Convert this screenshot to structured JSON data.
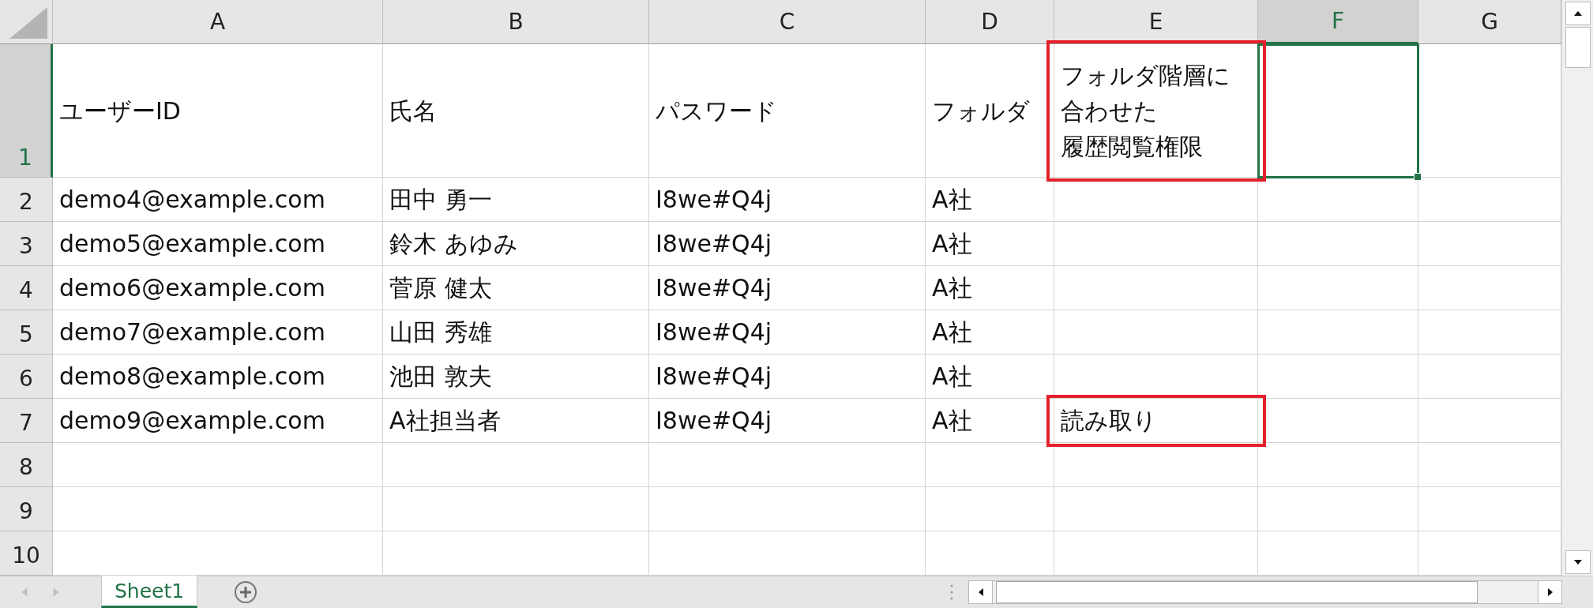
{
  "columns": [
    {
      "label": "A",
      "selected": false
    },
    {
      "label": "B",
      "selected": false
    },
    {
      "label": "C",
      "selected": false
    },
    {
      "label": "D",
      "selected": false
    },
    {
      "label": "E",
      "selected": false
    },
    {
      "label": "F",
      "selected": true
    },
    {
      "label": "G",
      "selected": false
    }
  ],
  "rows": [
    {
      "number": "1",
      "selected": true,
      "cells": [
        {
          "text": "ユーザーID",
          "selected": false,
          "marked": false
        },
        {
          "text": "氏名",
          "selected": false,
          "marked": false
        },
        {
          "text": "パスワード",
          "selected": false,
          "marked": false
        },
        {
          "text": "フォルダ",
          "selected": false,
          "marked": false
        },
        {
          "lines": [
            "フォルダ階層に",
            "合わせた",
            "履歴閲覧権限"
          ],
          "selected": false,
          "marked": true
        },
        {
          "selected": true,
          "marked": false
        },
        {
          "selected": false,
          "marked": false
        }
      ]
    },
    {
      "number": "2",
      "selected": false,
      "cells": [
        {
          "text": "demo4@example.com",
          "selected": false,
          "marked": false
        },
        {
          "text": "田中 勇一",
          "selected": false,
          "marked": false
        },
        {
          "text": "I8we#Q4j",
          "selected": false,
          "marked": false
        },
        {
          "text": "A社",
          "selected": false,
          "marked": false
        },
        {
          "selected": false,
          "marked": false
        },
        {
          "selected": false,
          "marked": false
        },
        {
          "selected": false,
          "marked": false
        }
      ]
    },
    {
      "number": "3",
      "selected": false,
      "cells": [
        {
          "text": "demo5@example.com",
          "selected": false,
          "marked": false
        },
        {
          "text": "鈴木 あゆみ",
          "selected": false,
          "marked": false
        },
        {
          "text": "I8we#Q4j",
          "selected": false,
          "marked": false
        },
        {
          "text": "A社",
          "selected": false,
          "marked": false
        },
        {
          "selected": false,
          "marked": false
        },
        {
          "selected": false,
          "marked": false
        },
        {
          "selected": false,
          "marked": false
        }
      ]
    },
    {
      "number": "4",
      "selected": false,
      "cells": [
        {
          "text": "demo6@example.com",
          "selected": false,
          "marked": false
        },
        {
          "text": "菅原 健太",
          "selected": false,
          "marked": false
        },
        {
          "text": "I8we#Q4j",
          "selected": false,
          "marked": false
        },
        {
          "text": "A社",
          "selected": false,
          "marked": false
        },
        {
          "selected": false,
          "marked": false
        },
        {
          "selected": false,
          "marked": false
        },
        {
          "selected": false,
          "marked": false
        }
      ]
    },
    {
      "number": "5",
      "selected": false,
      "cells": [
        {
          "text": "demo7@example.com",
          "selected": false,
          "marked": false
        },
        {
          "text": "山田 秀雄",
          "selected": false,
          "marked": false
        },
        {
          "text": "I8we#Q4j",
          "selected": false,
          "marked": false
        },
        {
          "text": "A社",
          "selected": false,
          "marked": false
        },
        {
          "selected": false,
          "marked": false
        },
        {
          "selected": false,
          "marked": false
        },
        {
          "selected": false,
          "marked": false
        }
      ]
    },
    {
      "number": "6",
      "selected": false,
      "cells": [
        {
          "text": "demo8@example.com",
          "selected": false,
          "marked": false
        },
        {
          "text": "池田 敦夫",
          "selected": false,
          "marked": false
        },
        {
          "text": "I8we#Q4j",
          "selected": false,
          "marked": false
        },
        {
          "text": "A社",
          "selected": false,
          "marked": false
        },
        {
          "selected": false,
          "marked": false
        },
        {
          "selected": false,
          "marked": false
        },
        {
          "selected": false,
          "marked": false
        }
      ]
    },
    {
      "number": "7",
      "selected": false,
      "cells": [
        {
          "text": "demo9@example.com",
          "selected": false,
          "marked": false
        },
        {
          "text": "A社担当者",
          "selected": false,
          "marked": false
        },
        {
          "text": "I8we#Q4j",
          "selected": false,
          "marked": false
        },
        {
          "text": "A社",
          "selected": false,
          "marked": false
        },
        {
          "text": "読み取り",
          "selected": false,
          "marked": true
        },
        {
          "selected": false,
          "marked": false
        },
        {
          "selected": false,
          "marked": false
        }
      ]
    },
    {
      "number": "8",
      "selected": false,
      "cells": [
        {
          "selected": false,
          "marked": false
        },
        {
          "selected": false,
          "marked": false
        },
        {
          "selected": false,
          "marked": false
        },
        {
          "selected": false,
          "marked": false
        },
        {
          "selected": false,
          "marked": false
        },
        {
          "selected": false,
          "marked": false
        },
        {
          "selected": false,
          "marked": false
        }
      ]
    },
    {
      "number": "9",
      "selected": false,
      "cells": [
        {
          "selected": false,
          "marked": false
        },
        {
          "selected": false,
          "marked": false
        },
        {
          "selected": false,
          "marked": false
        },
        {
          "selected": false,
          "marked": false
        },
        {
          "selected": false,
          "marked": false
        },
        {
          "selected": false,
          "marked": false
        },
        {
          "selected": false,
          "marked": false
        }
      ]
    },
    {
      "number": "10",
      "selected": false,
      "cells": [
        {
          "selected": false,
          "marked": false
        },
        {
          "selected": false,
          "marked": false
        },
        {
          "selected": false,
          "marked": false
        },
        {
          "selected": false,
          "marked": false
        },
        {
          "selected": false,
          "marked": false
        },
        {
          "selected": false,
          "marked": false
        },
        {
          "selected": false,
          "marked": false
        }
      ]
    }
  ],
  "sheet_tabs": [
    {
      "label": "Sheet1",
      "selected": true
    }
  ]
}
